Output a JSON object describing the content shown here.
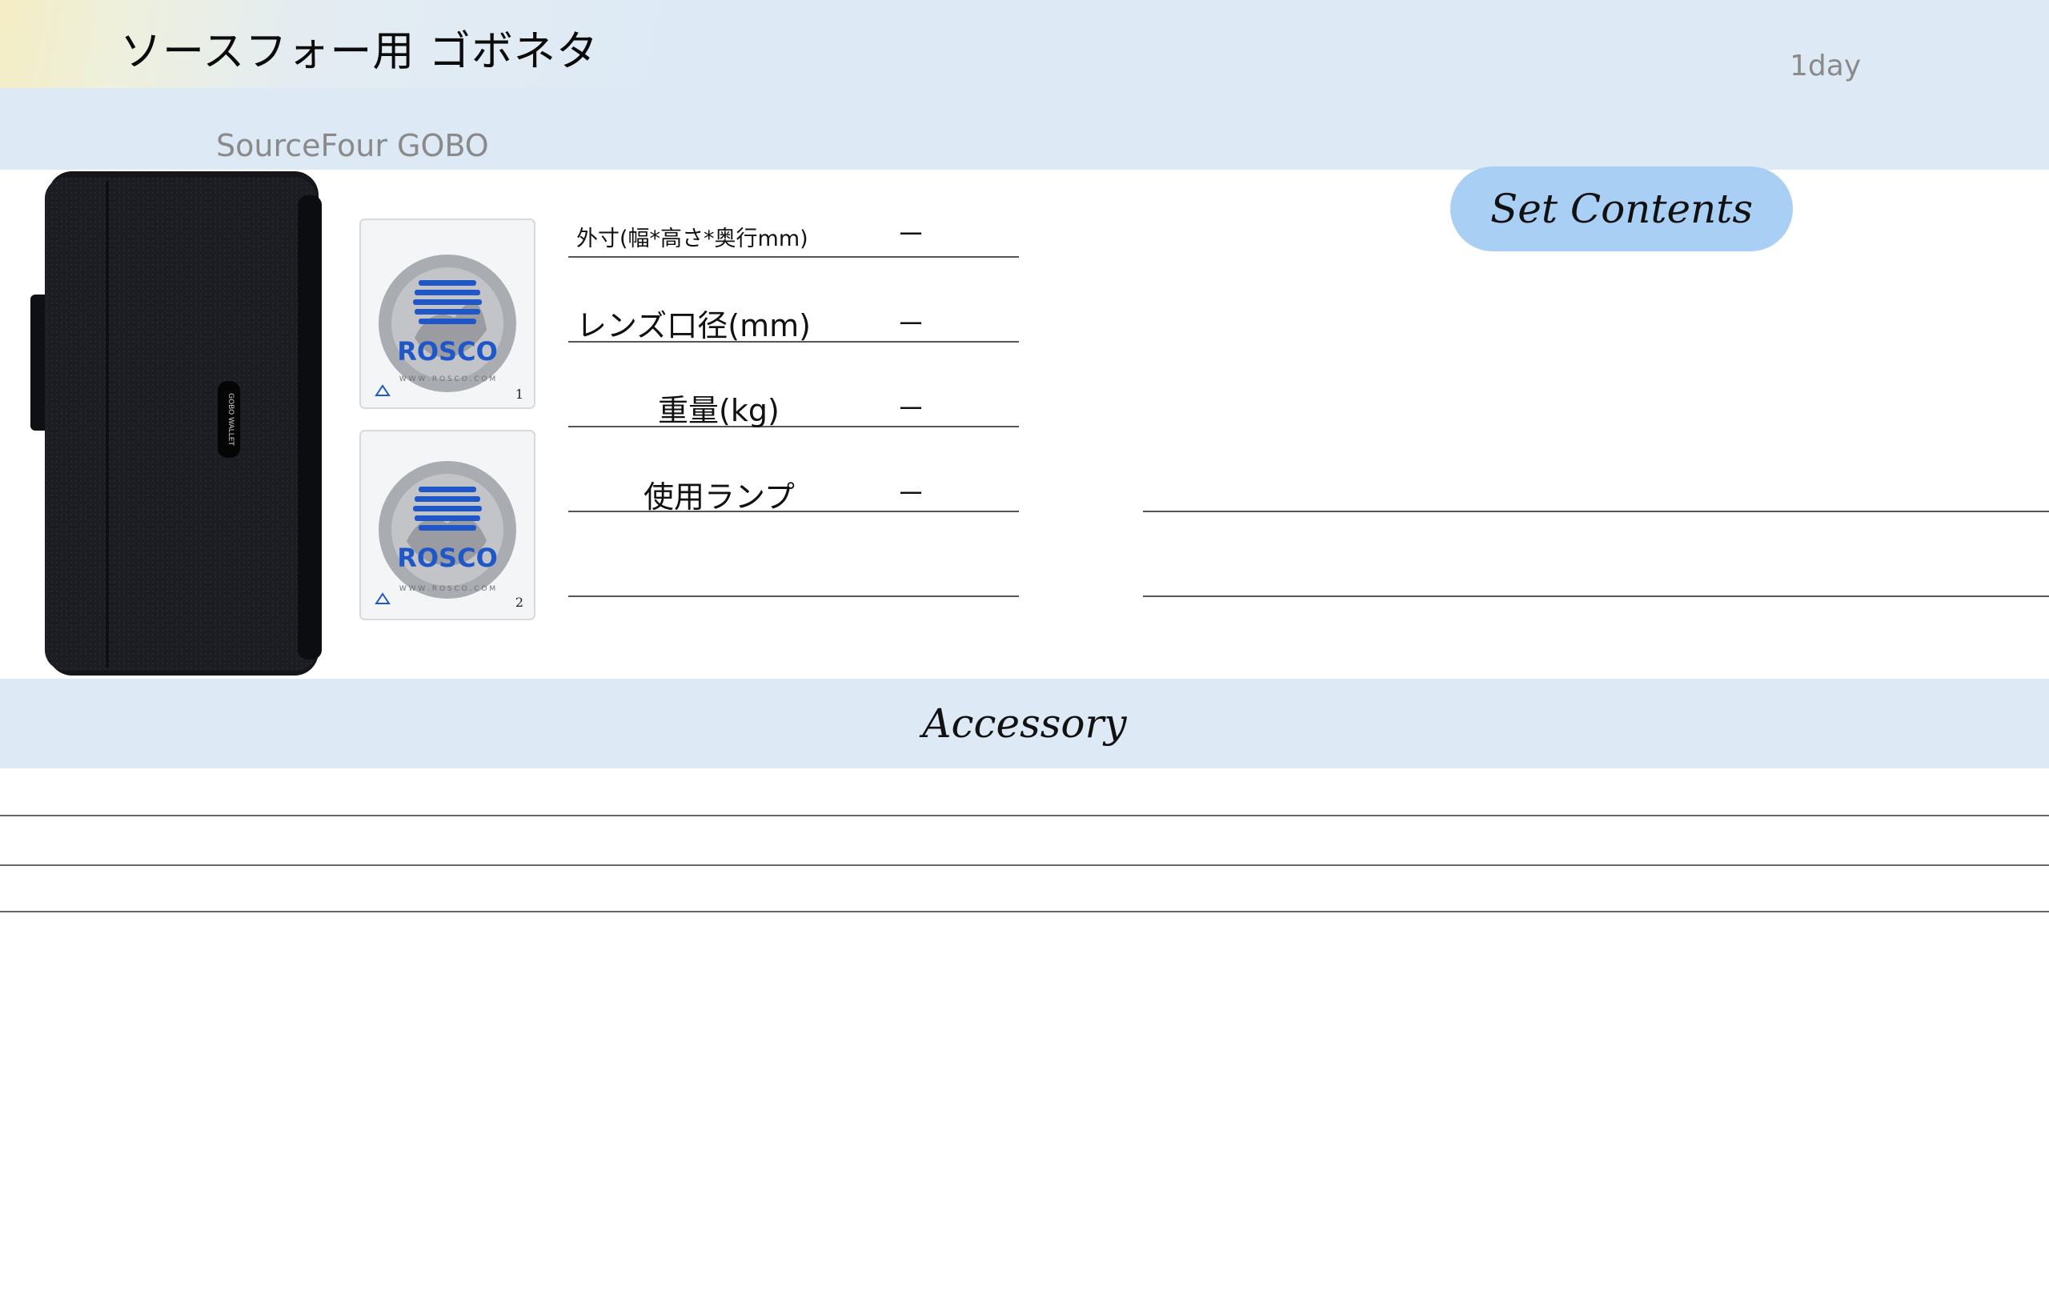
{
  "header": {
    "title": "ソースフォー用 ゴボネタ",
    "subtitle": "SourceFour GOBO",
    "duration": "1day"
  },
  "product": {
    "wallet_label": "GOBO WALLET",
    "gobos": [
      {
        "brand": "ROSCO",
        "url": "W W W . R O S C O . C O M",
        "number": "1"
      },
      {
        "brand": "ROSCO",
        "url": "W W W . R O S C O . C O M",
        "number": "2"
      }
    ]
  },
  "specs": [
    {
      "label": "外寸(幅*高さ*奥行mm)",
      "value": "－"
    },
    {
      "label": "レンズ口径(mm)",
      "value": "－"
    },
    {
      "label": "重量(kg)",
      "value": "－"
    },
    {
      "label": "使用ランプ",
      "value": "－"
    },
    {
      "label": "",
      "value": ""
    }
  ],
  "set_contents": {
    "label": "Set Contents"
  },
  "accessory": {
    "label": "Accessory"
  },
  "colors": {
    "band": "#ddeaf5",
    "pill": "#a9cff5",
    "rosco_blue": "#1f57c9"
  }
}
